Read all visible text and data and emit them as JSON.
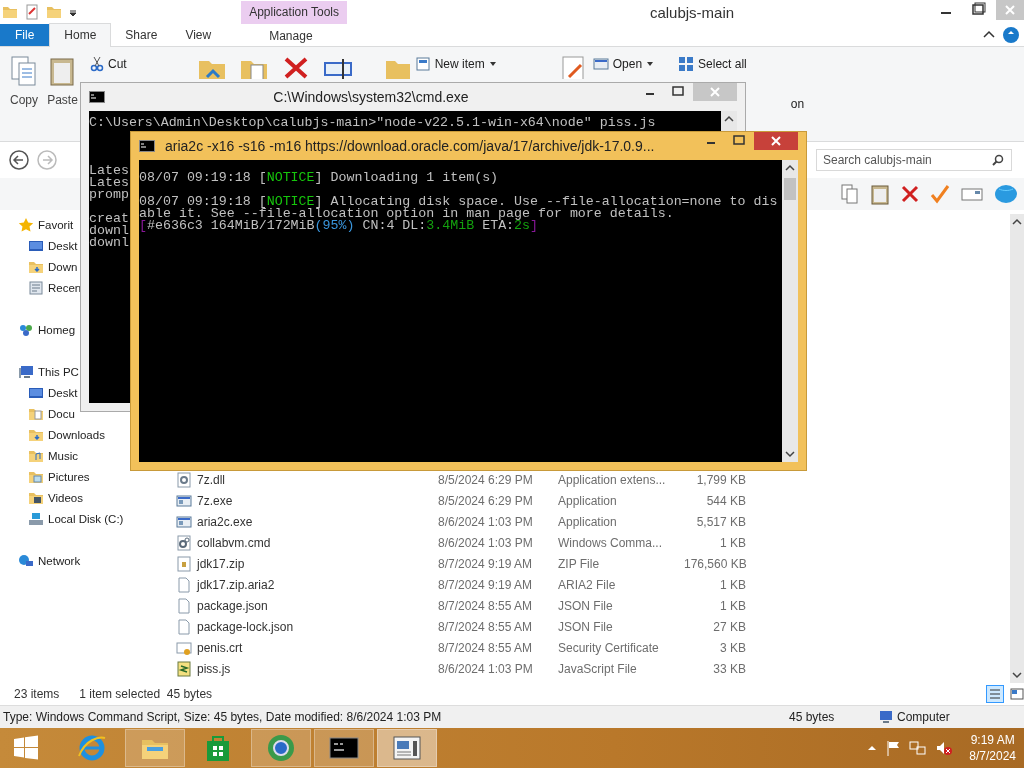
{
  "explorer": {
    "title": "calubjs-main",
    "ribbon_context": "Application Tools",
    "tabs": [
      {
        "label": "File",
        "kind": "file",
        "selected": false
      },
      {
        "label": "Home",
        "kind": "tab",
        "selected": true
      },
      {
        "label": "Share",
        "kind": "tab",
        "selected": false
      },
      {
        "label": "View",
        "kind": "tab",
        "selected": false
      },
      {
        "label": "Manage",
        "kind": "context",
        "selected": false
      }
    ],
    "commands": [
      {
        "label": "Copy",
        "kind": "copy"
      },
      {
        "label": "Paste",
        "kind": "paste"
      },
      {
        "label": "Cut",
        "kind": "cut"
      },
      {
        "label": "New item",
        "kind": "newitem"
      },
      {
        "label": "Open",
        "kind": "open"
      },
      {
        "label": "Select all",
        "kind": "selectall"
      },
      {
        "label": "on",
        "kind": "fragment"
      }
    ],
    "search": {
      "placeholder": "Search calubjs-main"
    },
    "sidebar": [
      {
        "label": "Favorit",
        "kind": "star",
        "children": [
          {
            "label": "Deskt",
            "kind": "desktop"
          },
          {
            "label": "Down",
            "kind": "downloads"
          },
          {
            "label": "Recen",
            "kind": "recent"
          }
        ]
      },
      {
        "label": "Homeg",
        "kind": "homegroup"
      },
      {
        "label": "This PC",
        "kind": "pc",
        "children": [
          {
            "label": "Deskt",
            "kind": "desktop"
          },
          {
            "label": "Docu",
            "kind": "documents"
          },
          {
            "label": "Downloads",
            "kind": "downloads"
          },
          {
            "label": "Music",
            "kind": "music"
          },
          {
            "label": "Pictures",
            "kind": "pictures"
          },
          {
            "label": "Videos",
            "kind": "videos"
          },
          {
            "label": "Local Disk (C:)",
            "kind": "disk"
          }
        ]
      },
      {
        "label": "Network",
        "kind": "network"
      }
    ],
    "files": [
      {
        "name": "7z.dll",
        "date": "8/5/2024 6:29 PM",
        "type": "Application extens...",
        "size": "1,799 KB",
        "kind": "dll"
      },
      {
        "name": "7z.exe",
        "date": "8/5/2024 6:29 PM",
        "type": "Application",
        "size": "544 KB",
        "kind": "exe"
      },
      {
        "name": "aria2c.exe",
        "date": "8/6/2024 1:03 PM",
        "type": "Application",
        "size": "5,517 KB",
        "kind": "exe"
      },
      {
        "name": "collabvm.cmd",
        "date": "8/6/2024 1:03 PM",
        "type": "Windows Comma...",
        "size": "1 KB",
        "kind": "cmd"
      },
      {
        "name": "jdk17.zip",
        "date": "8/7/2024 9:19 AM",
        "type": "ZIP File",
        "size": "176,560 KB",
        "kind": "zip"
      },
      {
        "name": "jdk17.zip.aria2",
        "date": "8/7/2024 9:19 AM",
        "type": "ARIA2 File",
        "size": "1 KB",
        "kind": "blank"
      },
      {
        "name": "package.json",
        "date": "8/7/2024 8:55 AM",
        "type": "JSON File",
        "size": "1 KB",
        "kind": "blank"
      },
      {
        "name": "package-lock.json",
        "date": "8/7/2024 8:55 AM",
        "type": "JSON File",
        "size": "27 KB",
        "kind": "blank"
      },
      {
        "name": "penis.crt",
        "date": "8/7/2024 8:55 AM",
        "type": "Security Certificate",
        "size": "3 KB",
        "kind": "cert"
      },
      {
        "name": "piss.js",
        "date": "8/6/2024 1:03 PM",
        "type": "JavaScript File",
        "size": "33 KB",
        "kind": "js"
      }
    ],
    "status": {
      "items": "23 items",
      "selection": "1 item selected  45 bytes"
    },
    "details": {
      "text": "Type: Windows Command Script, Size: 45 bytes, Date modified: 8/6/2024 1:03 PM",
      "size": "45 bytes",
      "location": "Computer"
    }
  },
  "cmd_window": {
    "title": "C:\\Windows\\system32\\cmd.exe",
    "lines": [
      {
        "kind": "text",
        "text": "C:\\Users\\Admin\\Desktop\\calubjs-main>\"node-v22.5.1-win-x64\\node\" piss.js"
      },
      {
        "kind": "blank"
      },
      {
        "kind": "blank"
      },
      {
        "kind": "blank"
      },
      {
        "kind": "text",
        "text": "Lates"
      },
      {
        "kind": "text",
        "text": "Lates"
      },
      {
        "kind": "text",
        "text": "promp"
      },
      {
        "kind": "blank"
      },
      {
        "kind": "text",
        "text": "creat"
      },
      {
        "kind": "text",
        "text": "downl"
      },
      {
        "kind": "text",
        "text": "downl"
      }
    ]
  },
  "aria_window": {
    "title": "aria2c  -x16 -s16 -m16 https://download.oracle.com/java/17/archive/jdk-17.0.9...",
    "lines": [
      {
        "kind": "text",
        "segments": [
          {
            "text": "08/07 09:19:18 [",
            "color": "#c0c0c0"
          },
          {
            "text": "NOTICE",
            "color": "#16c60c"
          },
          {
            "text": "] Downloading 1 item(s)",
            "color": "#c0c0c0"
          }
        ]
      },
      {
        "kind": "blank"
      },
      {
        "kind": "text",
        "segments": [
          {
            "text": "08/07 09:19:18 [",
            "color": "#c0c0c0"
          },
          {
            "text": "NOTICE",
            "color": "#16c60c"
          },
          {
            "text": "] Allocating disk space. Use --file-allocation=none to dis",
            "color": "#c0c0c0"
          }
        ]
      },
      {
        "kind": "text",
        "segments": [
          {
            "text": "able it. See --file-allocation option in man page for more details.",
            "color": "#c0c0c0"
          }
        ]
      },
      {
        "kind": "text",
        "segments": [
          {
            "text": "[",
            "color": "#881798"
          },
          {
            "text": "#e636c3 164MiB/172MiB",
            "color": "#c0c0c0"
          },
          {
            "text": "(95%)",
            "color": "#3a96dd"
          },
          {
            "text": " CN:4 DL:",
            "color": "#c0c0c0"
          },
          {
            "text": "3.4MiB",
            "color": "#13a10e"
          },
          {
            "text": " ETA:",
            "color": "#c0c0c0"
          },
          {
            "text": "2s",
            "color": "#13a10e"
          },
          {
            "text": "]",
            "color": "#881798"
          }
        ]
      }
    ]
  },
  "taskbar": {
    "apps": [
      {
        "kind": "ie",
        "running": false,
        "selected": false
      },
      {
        "kind": "explorer",
        "running": true,
        "selected": false
      },
      {
        "kind": "store",
        "running": false,
        "selected": false
      },
      {
        "kind": "globe",
        "running": true,
        "selected": false
      },
      {
        "kind": "console",
        "running": true,
        "selected": false
      },
      {
        "kind": "window",
        "running": true,
        "selected": true
      }
    ],
    "time": "9:19 AM",
    "date": "8/7/2024"
  }
}
